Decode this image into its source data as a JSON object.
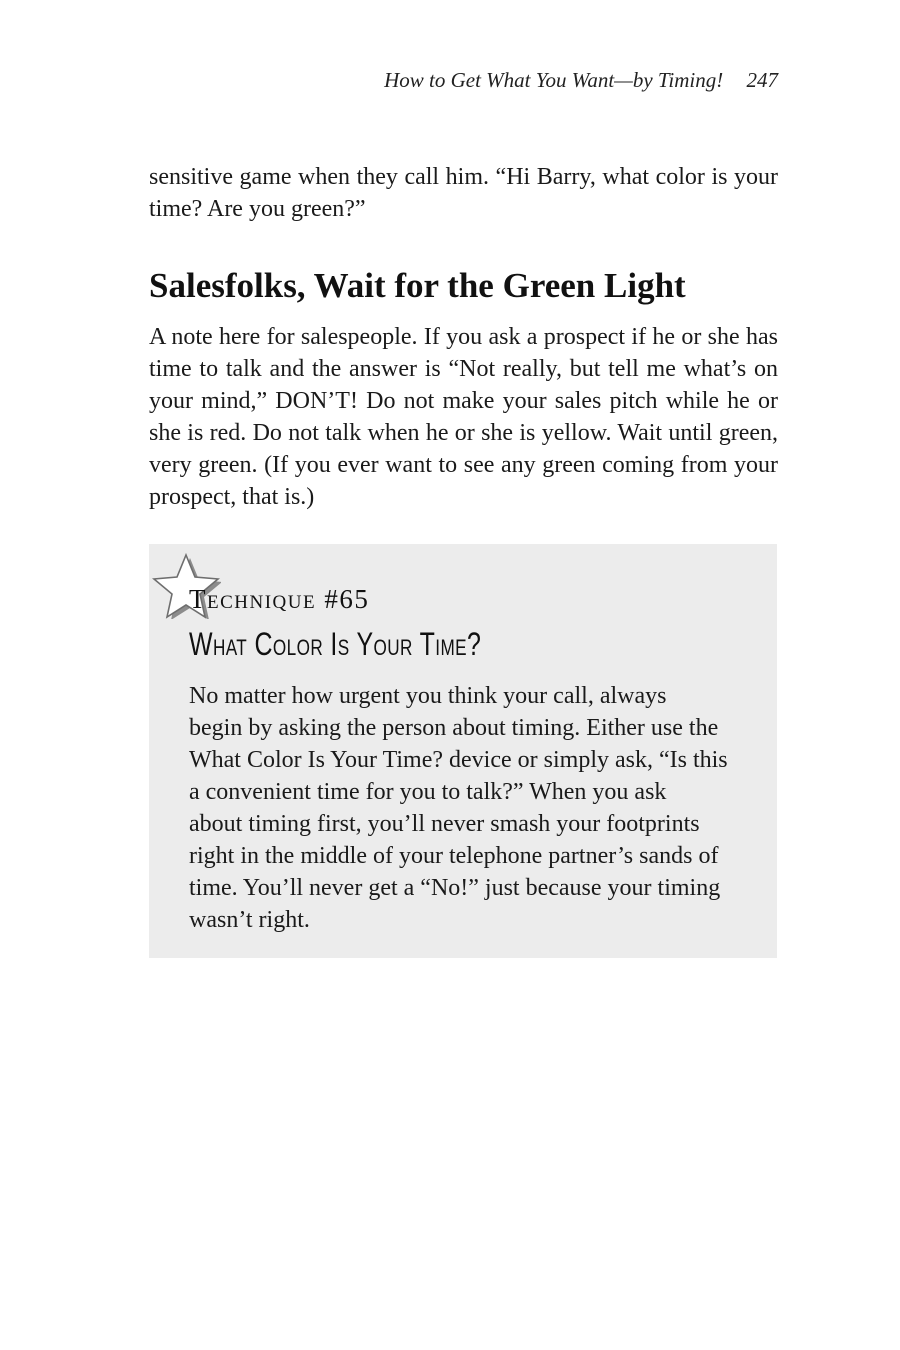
{
  "running_head": {
    "title": "How to Get What You Want—by Timing!",
    "page_number": "247"
  },
  "paragraphs": [
    "sensitive game when they call him. “Hi Barry, what color is your time? Are you green?”",
    "A note here for salespeople. If you ask a prospect if he or she has time to talk and the answer is “Not really, but tell me what’s on your mind,” DON’T! Do not make your sales pitch while he or she is red. Do not talk when he or she is yellow. Wait until green, very green. (If you ever want to see any green coming from your prospect, that is.)"
  ],
  "section_heading": "Salesfolks, Wait for the Green Light",
  "technique": {
    "icon": "star-icon",
    "label": "Technique #65",
    "title": "What Color Is Your Time?",
    "body_lines": [
      "No matter how urgent you think your call, always",
      "begin by asking the person about timing. Either use the",
      "What Color Is Your Time? device or simply ask, “Is this",
      "a convenient time for you to talk?” When you ask",
      "about timing first, you’ll never smash your footprints",
      "right in the middle of your telephone partner’s sands of",
      "time. You’ll never get a “No!” just because your timing",
      "wasn’t right."
    ]
  },
  "colors": {
    "box_background": "#ececec",
    "star_fill": "#ffffff",
    "star_shadow": "#8c8c8c"
  }
}
